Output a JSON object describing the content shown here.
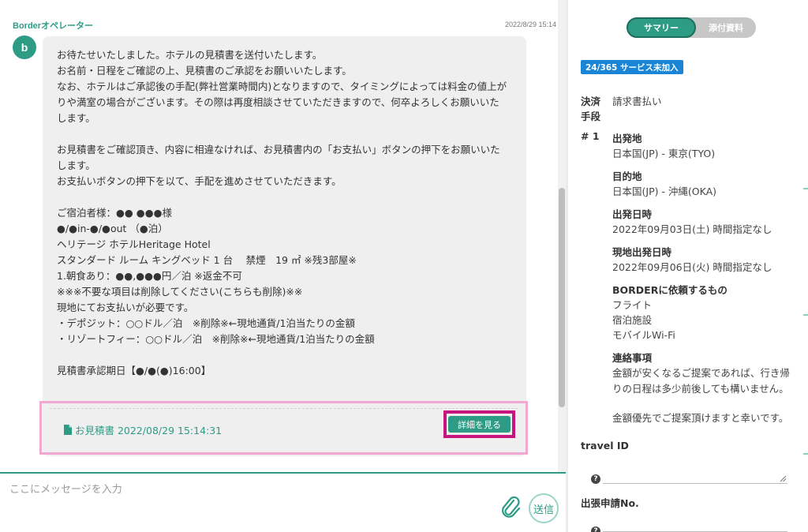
{
  "chat": {
    "sender": "Borderオペレーター",
    "timestamp": "2022/8/29 15:14",
    "avatar_letter": "b",
    "message_lines": [
      "お待たせいたしました。ホテルの見積書を送付いたします。",
      "お名前・日程をご確認の上、見積書のご承認をお願いいたします。",
      "なお、ホテルはご承認後の手配(弊社営業時間内)となりますので、タイミングによっては料金の値上が",
      "りや満室の場合がございます。その際は再度相談させていただきますので、何卒よろしくお願いいた",
      "します。",
      "",
      "お見積書をご確認頂き、内容に相違なければ、お見積書内の「お支払い」ボタンの押下をお願いいた",
      "します。",
      "お支払いボタンの押下を以て、手配を進めさせていただきます。",
      "",
      "ご宿泊者様：●● ●●●様",
      "●/●in-●/●out （●泊）",
      "ヘリテージ ホテルHeritage Hotel",
      "スタンダード ルーム キングベッド 1 台　 禁煙　19 ㎡ ※残3部屋※",
      "1.朝食あり：●●,●●●円／泊 ※返金不可",
      "※※※不要な項目は削除してください(こちらも削除)※※",
      "現地にてお支払いが必要です。",
      "・デポジット：○○ドル／泊　※削除※←現地通貨/1泊当たりの金額",
      "・リゾートフィー：○○ドル／泊　※削除※←現地通貨/1泊当たりの金額",
      "",
      "見積書承認期日【●/●(●)16:00】"
    ],
    "attachment": {
      "link_text": "お見積書 2022/08/29 15:14:31",
      "detail_button": "詳細を見る"
    },
    "input_placeholder": "ここにメッセージを入力",
    "send_button": "送信"
  },
  "summary": {
    "tabs": {
      "summary": "サマリー",
      "attachments": "添付資料"
    },
    "service_badge": "24/365 サービス未加入",
    "payment_label_1": "決済",
    "payment_label_2": "手段",
    "payment_value": "請求書払い",
    "item_number": "# 1",
    "departure_label": "出発地",
    "departure_value": "日本国(JP) - 東京(TYO)",
    "destination_label": "目的地",
    "destination_value": "日本国(JP) - 沖縄(OKA)",
    "departure_date_label": "出発日時",
    "departure_date_value": "2022年09月03日(土) 時間指定なし",
    "local_departure_label": "現地出発日時",
    "local_departure_value": "2022年09月06日(火) 時間指定なし",
    "request_label": "BORDERに依頼するもの",
    "request_items": [
      "フライト",
      "宿泊施設",
      "モバイルWi-Fi"
    ],
    "notes_label": "連絡事項",
    "notes_lines": [
      "金額が安くなるご提案であれば、行き帰",
      "りの日程は多少前後しても構いません。",
      "",
      "金額優先でご提案頂けますと幸いです。"
    ],
    "travel_id_label": "travel ID",
    "travel_id_value": "",
    "business_no_label": "出張申請No.",
    "business_no_value": ""
  },
  "colors": {
    "accent": "#2e9c84",
    "highlight_outer": "#f0a8d3",
    "highlight_inner": "#c8157d",
    "badge": "#1a85d6"
  }
}
